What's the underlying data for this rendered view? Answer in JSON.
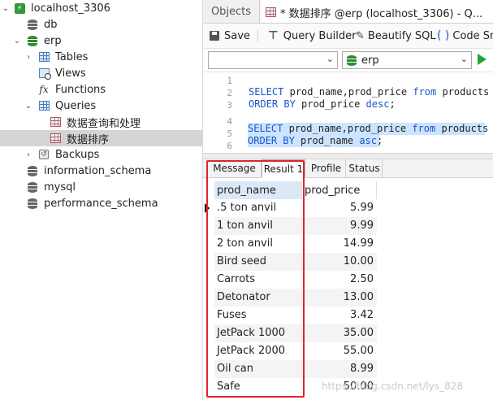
{
  "tree": {
    "connection": "localhost_3306",
    "databases": [
      {
        "name": "db"
      },
      {
        "name": "erp"
      },
      {
        "name": "information_schema"
      },
      {
        "name": "mysql"
      },
      {
        "name": "performance_schema"
      }
    ],
    "erp_children": [
      "Tables",
      "Views",
      "Functions",
      "Queries",
      "Backups"
    ],
    "queries": [
      "数据查询和处理",
      "数据排序"
    ],
    "selected": "数据排序"
  },
  "tabs": {
    "objects": "Objects",
    "query_tab": "* 数据排序 @erp (localhost_3306) - Q..."
  },
  "toolbar": {
    "save": "Save",
    "query_builder": "Query Builder",
    "beautify": "Beautify SQL",
    "code_snippet": "Code Sn"
  },
  "selectors": {
    "connection": "",
    "database": "erp"
  },
  "editor": {
    "line_numbers": [
      "1",
      "2",
      "3",
      "4",
      "5",
      "6"
    ],
    "lines": [
      "",
      "SELECT prod_name,prod_price from products",
      "ORDER BY prod_price desc;",
      "",
      "SELECT prod_name,prod_price from products",
      "ORDER BY prod_name asc;"
    ]
  },
  "result_tabs": [
    "Message",
    "Result 1",
    "Profile",
    "Status"
  ],
  "active_result_tab": "Result 1",
  "grid": {
    "columns": [
      "prod_name",
      "prod_price"
    ],
    "rows": [
      [
        ".5 ton anvil",
        "5.99"
      ],
      [
        "1 ton anvil",
        "9.99"
      ],
      [
        "2 ton anvil",
        "14.99"
      ],
      [
        "Bird seed",
        "10.00"
      ],
      [
        "Carrots",
        "2.50"
      ],
      [
        "Detonator",
        "13.00"
      ],
      [
        "Fuses",
        "3.42"
      ],
      [
        "JetPack 1000",
        "35.00"
      ],
      [
        "JetPack 2000",
        "55.00"
      ],
      [
        "Oil can",
        "8.99"
      ],
      [
        "Safe",
        "50.00"
      ]
    ]
  },
  "watermark": "https://blog.csdn.net/lys_828",
  "colors": {
    "accent_blue": "#1a56c8",
    "db_green": "#2e8b2e",
    "highlight_red": "#e0242b",
    "selection_blue": "#cce4ff"
  }
}
